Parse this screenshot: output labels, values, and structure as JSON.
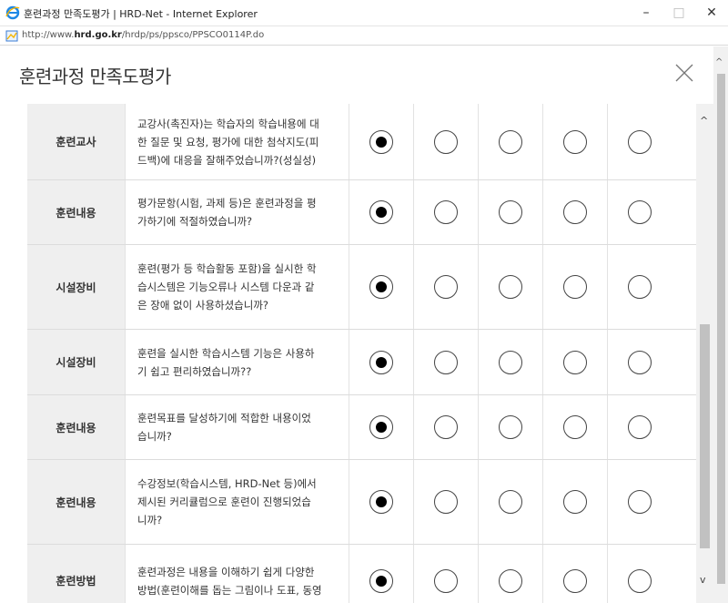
{
  "window": {
    "title": "훈련과정 만족도평가 | HRD-Net - Internet Explorer",
    "minimize_label": "–",
    "maximize_label": "□",
    "close_label": "✕"
  },
  "address": {
    "prefix": "http://www.",
    "domain": "hrd.go.kr",
    "path": "/hrdp/ps/ppsco/PPSCO0114P.do"
  },
  "popup": {
    "title": "훈련과정 만족도평가"
  },
  "questions": [
    {
      "category": "훈련교사",
      "lines": [
        "교강사(촉진자)는 학습자의 학습내용에 대",
        "한 질문 및 요청, 평가에 대한 첨삭지도(피",
        "드백)에 대응을 잘해주었습니까?(성실성)"
      ],
      "selected": 0
    },
    {
      "category": "훈련내용",
      "lines": [
        "평가문항(시험, 과제 등)은 훈련과정을 평",
        "가하기에 적절하였습니까?"
      ],
      "selected": 0
    },
    {
      "category": "시설장비",
      "lines": [
        "훈련(평가 등 학습활동 포함)을 실시한 학",
        "습시스템은 기능오류나 시스템 다운과 같",
        "은 장애 없이 사용하셨습니까?"
      ],
      "selected": 0
    },
    {
      "category": "시설장비",
      "lines": [
        "훈련을 실시한 학습시스템 기능은 사용하",
        "기 쉽고 편리하였습니까??"
      ],
      "selected": 0
    },
    {
      "category": "훈련내용",
      "lines": [
        "훈련목표를 달성하기에 적합한 내용이었",
        "습니까?"
      ],
      "selected": 0
    },
    {
      "category": "훈련내용",
      "lines": [
        "수강정보(학습시스템, HRD-Net 등)에서",
        "제시된 커리큘럼으로 훈련이 진행되었습",
        "니까?"
      ],
      "selected": 0
    },
    {
      "category": "훈련방법",
      "lines": [
        "훈련과정은 내용을 이해하기 쉽게 다양한",
        "방법(훈련이해를 돕는 그림이나 도표, 동영"
      ],
      "selected": 0
    }
  ]
}
